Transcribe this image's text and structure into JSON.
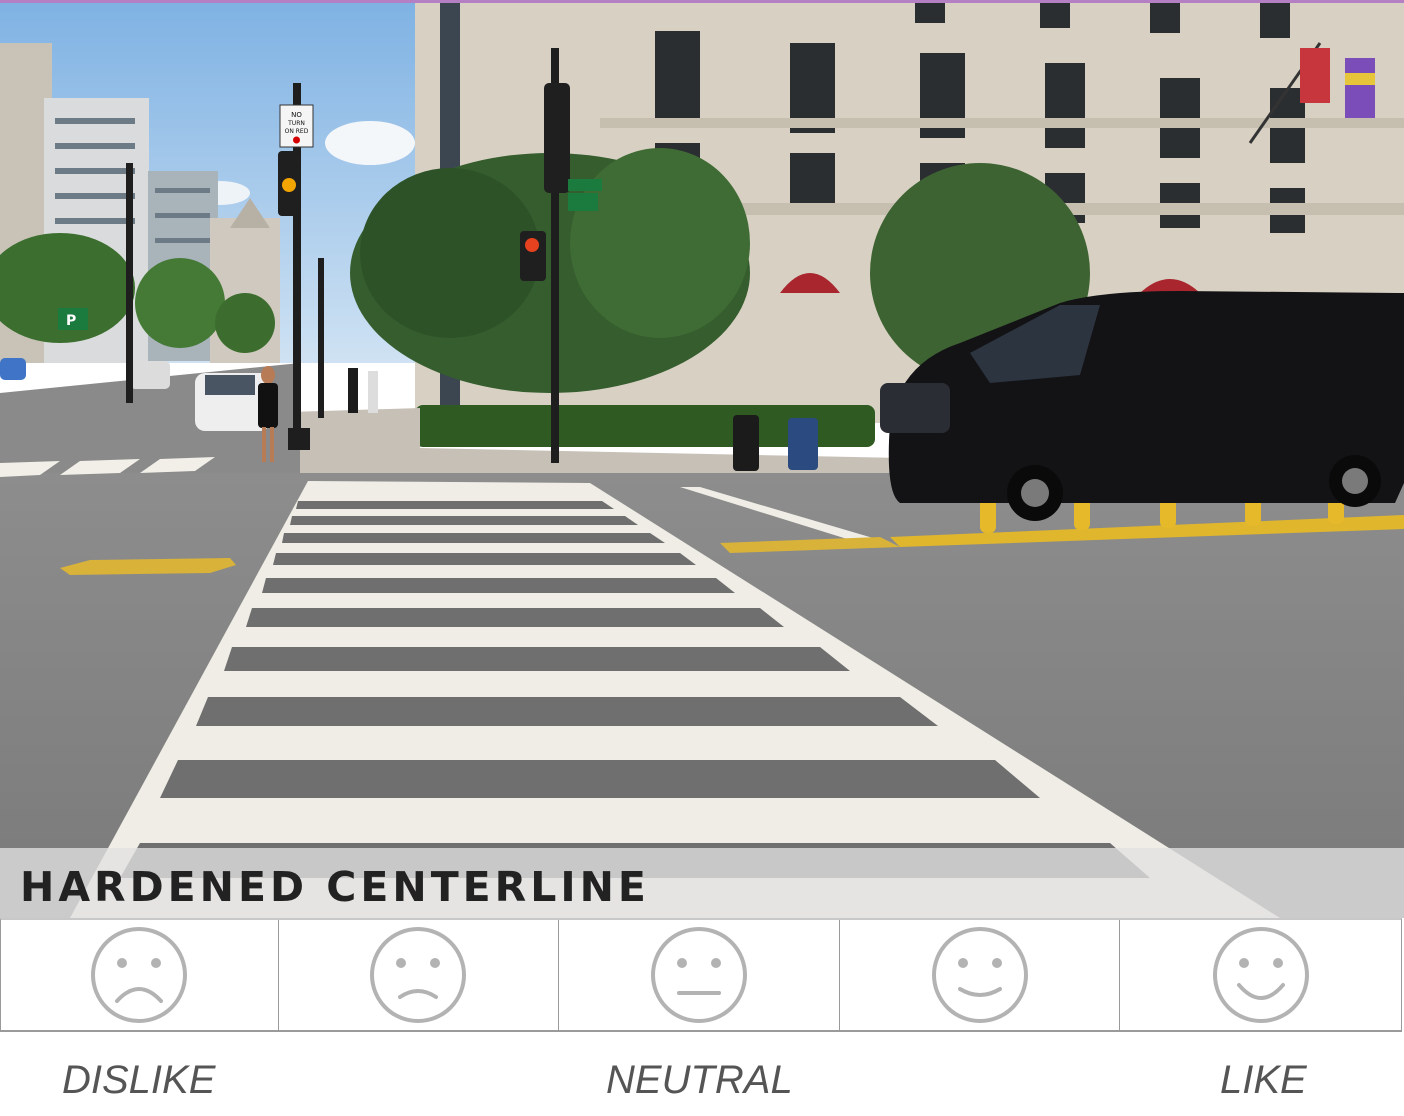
{
  "title": "HARDENED CENTERLINE",
  "scale_labels": {
    "dislike": "DISLIKE",
    "neutral": "NEUTRAL",
    "like": "LIKE"
  },
  "rating_options": [
    {
      "icon": "very-sad-face-icon",
      "value": 1
    },
    {
      "icon": "sad-face-icon",
      "value": 2
    },
    {
      "icon": "neutral-face-icon",
      "value": 3
    },
    {
      "icon": "smiling-face-icon",
      "value": 4
    },
    {
      "icon": "very-happy-face-icon",
      "value": 5
    }
  ],
  "colors": {
    "face_stroke": "#b3b3b3",
    "label_text": "#555555",
    "title_text": "#222222",
    "top_rule": "#b57fc4"
  },
  "photo_signs": {
    "no_turn_sign": "NO TURN ON RED",
    "parking_sign": "P"
  }
}
